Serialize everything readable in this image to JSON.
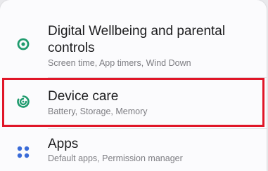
{
  "colors": {
    "accent_green": "#1f9b6e",
    "apps_blue": "#3a6bd8",
    "highlight_red": "#e01628"
  },
  "settings": {
    "items": [
      {
        "title_line1": "Digital Wellbeing and parental",
        "title_line2": "controls",
        "subtitle": "Screen time, App timers, Wind Down",
        "icon": "wellbeing-icon"
      },
      {
        "title": "Device care",
        "subtitle": "Battery, Storage, Memory",
        "icon": "device-care-icon",
        "highlighted": true
      },
      {
        "title": "Apps",
        "subtitle": "Default apps, Permission manager",
        "icon": "apps-grid-icon"
      }
    ]
  }
}
